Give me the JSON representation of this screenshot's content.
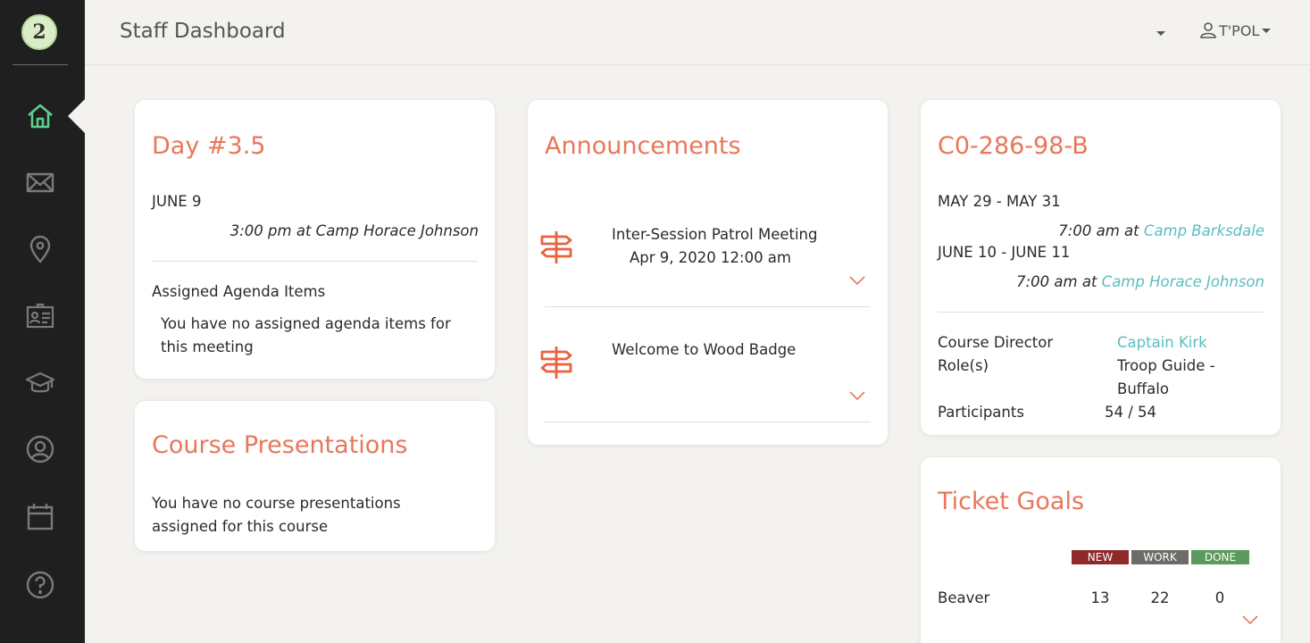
{
  "header": {
    "title": "Staff Dashboard",
    "user": "T'POL"
  },
  "sidebar": {
    "logo": "2",
    "items": [
      {
        "name": "home",
        "icon": "home-icon"
      },
      {
        "name": "messages",
        "icon": "envelope-icon"
      },
      {
        "name": "locations",
        "icon": "map-pin-icon"
      },
      {
        "name": "roster",
        "icon": "id-card-icon"
      },
      {
        "name": "courses",
        "icon": "graduation-cap-icon"
      },
      {
        "name": "profile",
        "icon": "user-circle-icon"
      },
      {
        "name": "calendar",
        "icon": "calendar-icon"
      },
      {
        "name": "help",
        "icon": "help-icon"
      }
    ]
  },
  "day": {
    "title": "Day #3.5",
    "date": "JUNE 9",
    "time": "3:00 pm",
    "at": "at",
    "location": "Camp Horace Johnson",
    "agenda_heading": "Assigned Agenda Items",
    "agenda_empty_line1": "You have no assigned agenda items for",
    "agenda_empty_line2": "this meeting"
  },
  "presentations": {
    "title": "Course Presentations",
    "empty_line1": "You have no course presentations",
    "empty_line2": "assigned for this course"
  },
  "announcements": {
    "title": "Announcements",
    "items": [
      {
        "title": "Inter-Session Patrol Meeting",
        "date": "Apr 9, 2020 12:00 am"
      },
      {
        "title": "Welcome to Wood Badge",
        "date": ""
      }
    ]
  },
  "course": {
    "code": "C0-286-98-B",
    "sessions": [
      {
        "dates": "MAY 29 - MAY 31",
        "time": "7:00 am",
        "at": "at",
        "location": "Camp Barksdale"
      },
      {
        "dates": "JUNE 10 - JUNE 11",
        "time": "7:00 am",
        "at": "at",
        "location": "Camp Horace Johnson"
      }
    ],
    "director_label": "Course Director",
    "director": "Captain Kirk",
    "roles_label": "Role(s)",
    "roles_line1": "Troop Guide -",
    "roles_line2": "Buffalo",
    "participants_label": "Participants",
    "participants": "54 / 54"
  },
  "tickets": {
    "title": "Ticket Goals",
    "columns": [
      "NEW",
      "WORK",
      "DONE"
    ],
    "rows": [
      {
        "name": "Beaver",
        "new": "13",
        "work": "22",
        "done": "0"
      }
    ]
  },
  "colors": {
    "accent": "#e8775a",
    "link": "#5bbdbd",
    "sidebar": "#1f1f1f",
    "active_icon": "#5ccf8a",
    "new": "#8e2a2a",
    "work": "#6f6c68",
    "done": "#5b9a5b"
  }
}
